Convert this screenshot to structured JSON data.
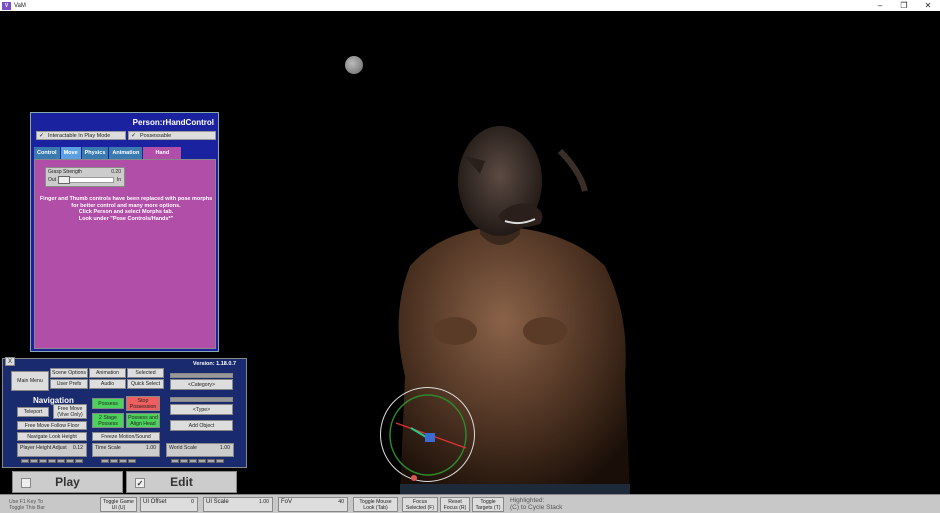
{
  "window": {
    "title": "VaM",
    "minimize": "–",
    "restore": "❐",
    "close": "✕"
  },
  "person_panel": {
    "title": "Person:rHandControl",
    "check_interactable": "Interactable In Play Mode",
    "check_possessable": "Possessable",
    "tabs": [
      "Control",
      "Move",
      "Physics",
      "Animation",
      "Hand"
    ],
    "grasp": {
      "label": "Grasp Strength",
      "value": "0.20",
      "out": "Out",
      "in": "In",
      "fraction": 0.2
    },
    "note": [
      "Finger and Thumb controls have been replaced with pose morphs",
      "for better control and many more options.",
      "Click Person and select Morphs tab.",
      "Look under \"Pose Controls/Hands*\""
    ]
  },
  "main_menu": {
    "close": "X",
    "version": "Version: 1.18.0.7",
    "main_menu": "Main Menu",
    "scene_options": "Scene Options",
    "animation": "Animation",
    "selected": "Selected",
    "user_prefs": "User Prefs",
    "audio": "Audio",
    "quick_select": "Quick Select",
    "category": "<Category>",
    "type": "<Type>",
    "add_object": "Add Object",
    "navigation": "Navigation",
    "teleport": "Teleport",
    "free_move_vive": "Free Move (Vive Only)",
    "possess": "Possess",
    "stop_possession": "Stop Possession",
    "two_stage_possess": "2 Stage Possess",
    "possess_align": "Possess and Align Head",
    "free_move_follow": "Free Move Follow Floor",
    "navigate_look": "Navigate Look Height",
    "freeze_motion": "Freeze Motion/Sound",
    "player_height_label": "Player Height Adjust",
    "player_height_value": "0.12",
    "time_scale_label": "Time Scale",
    "time_scale_value": "1.00",
    "world_scale_label": "World Scale",
    "world_scale_value": "1.00"
  },
  "play_edit": {
    "play": "Play",
    "edit": "Edit",
    "edit_check": "✓"
  },
  "bottom_bar": {
    "hint_line1": "Use F1 Key To",
    "hint_line2": "Toggle This Bar",
    "toggle_game_ui": [
      "Toggle Game",
      "UI (U)"
    ],
    "ui_offset_label": "UI Offset",
    "ui_offset_value": "0",
    "ui_scale_label": "UI Scale",
    "ui_scale_value": "1.00",
    "fov_label": "FoV",
    "fov_value": "40",
    "toggle_mouse_look": [
      "Toggle Mouse",
      "Look (Tab)"
    ],
    "focus_selected": [
      "Focus",
      "Selected (F)"
    ],
    "reset_focus": [
      "Reset",
      "Focus (R)"
    ],
    "toggle_targets": [
      "Toggle",
      "Targets (T)"
    ],
    "highlighted": [
      "Highlighted:",
      "(C) to Cycle Stack"
    ]
  },
  "colors": {
    "panel_blue": "#1a22a0",
    "hand_tab": "#b04ea8",
    "possess_green": "#4cd35c",
    "stop_red": "#ef5f5f"
  }
}
